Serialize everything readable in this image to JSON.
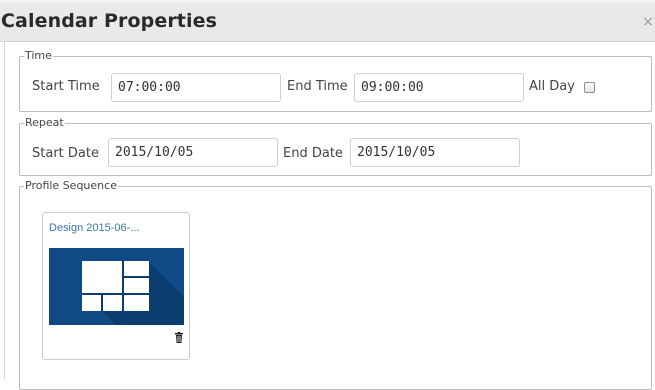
{
  "dialog": {
    "title": "Calendar Properties",
    "close_label": "×"
  },
  "time": {
    "legend": "Time",
    "start_label": "Start Time",
    "start_value": "07:00:00",
    "end_label": "End Time",
    "end_value": "09:00:00",
    "allday_label": "All Day",
    "allday_checked": false
  },
  "repeat": {
    "legend": "Repeat",
    "start_label": "Start Date",
    "start_value": "2015/10/05",
    "end_label": "End Date",
    "end_value": "2015/10/05"
  },
  "profile": {
    "legend": "Profile Sequence",
    "items": [
      {
        "title": "Design 2015-06-...",
        "icon": "windows-tiles-icon"
      }
    ]
  },
  "colors": {
    "thumb_bg": "#0f4a84",
    "link": "#3a77b5"
  }
}
